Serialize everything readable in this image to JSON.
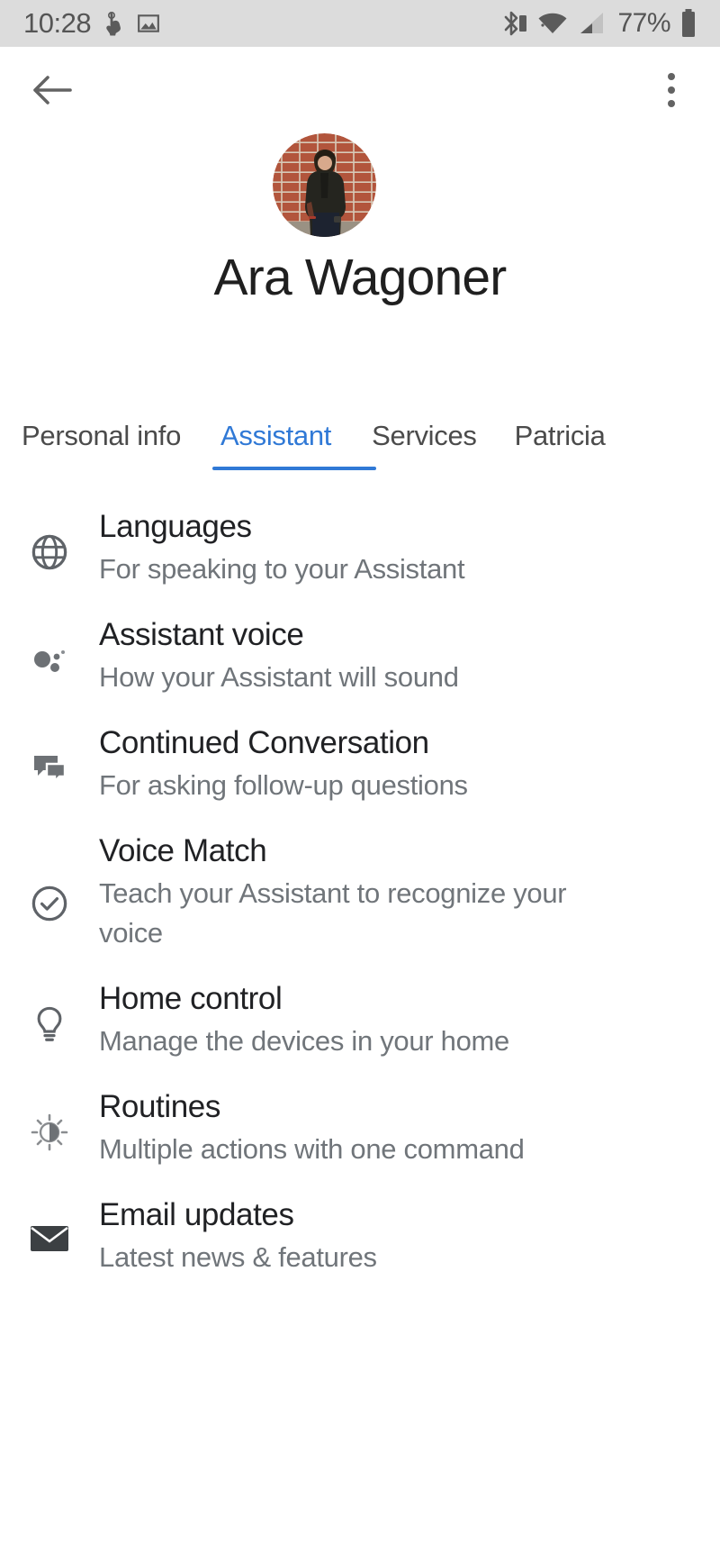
{
  "statusbar": {
    "time": "10:28",
    "battery_percent": "77%",
    "icons": [
      "touch-pointer-icon",
      "image-icon",
      "bluetooth-icon",
      "wifi-icon",
      "cell-signal-icon",
      "battery-icon"
    ]
  },
  "appbar": {
    "back_icon": "back-arrow-icon",
    "overflow_icon": "more-vertical-icon"
  },
  "profile": {
    "name": "Ara Wagoner",
    "avatar_alt": "avatar"
  },
  "tabs": {
    "items": [
      {
        "label": "Personal info",
        "active": false
      },
      {
        "label": "Assistant",
        "active": true
      },
      {
        "label": "Services",
        "active": false
      },
      {
        "label": "Patricia",
        "active": false
      }
    ],
    "active_color": "#3079d6"
  },
  "settings": {
    "items": [
      {
        "icon": "globe-icon",
        "title": "Languages",
        "subtitle": "For speaking to your Assistant"
      },
      {
        "icon": "assistant-dots-icon",
        "title": "Assistant voice",
        "subtitle": "How your Assistant will sound"
      },
      {
        "icon": "chat-bubbles-icon",
        "title": "Continued Conversation",
        "subtitle": "For asking follow-up questions"
      },
      {
        "icon": "check-circle-icon",
        "title": "Voice Match",
        "subtitle": "Teach your Assistant to recognize your voice"
      },
      {
        "icon": "lightbulb-icon",
        "title": "Home control",
        "subtitle": "Manage the devices in your home"
      },
      {
        "icon": "brightness-icon",
        "title": "Routines",
        "subtitle": "Multiple actions with one command"
      },
      {
        "icon": "envelope-icon",
        "title": "Email updates",
        "subtitle": "Latest news & features"
      }
    ]
  },
  "colors": {
    "accent": "#3079d6",
    "statusbar_bg": "#dcdcdc",
    "title_text": "#202124",
    "subtitle_text": "#70757a",
    "icon_gray": "#5f6368"
  }
}
